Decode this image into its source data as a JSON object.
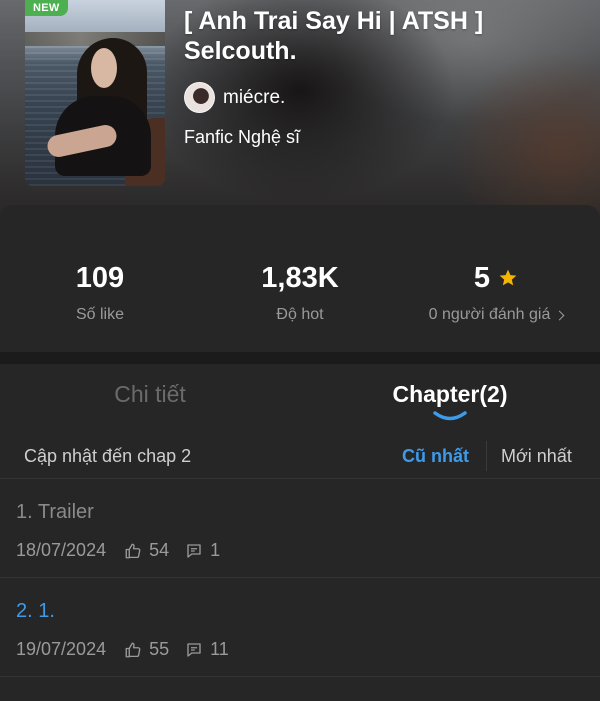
{
  "story": {
    "badge": "NEW",
    "title": "[ Anh Trai Say Hi | ATSH ] Selcouth.",
    "author": "miécre.",
    "genre": "Fanfic Nghệ sĩ"
  },
  "stats": {
    "likes": {
      "value": "109",
      "label": "Số like"
    },
    "hot": {
      "value": "1,83K",
      "label": "Độ hot"
    },
    "rating": {
      "value": "5",
      "label": "0 người đánh giá"
    }
  },
  "tabs": {
    "detail": "Chi tiết",
    "chapters": "Chapter(2)",
    "active": "chapters"
  },
  "chapter_list": {
    "update_text": "Cập nhật đến chap 2",
    "sort_oldest": "Cũ nhất",
    "sort_newest": "Mới nhất",
    "sort_active": "oldest",
    "items": [
      {
        "title": "1. Trailer",
        "date": "18/07/2024",
        "likes": "54",
        "comments": "1",
        "read": true
      },
      {
        "title": "2. 1.",
        "date": "19/07/2024",
        "likes": "55",
        "comments": "11",
        "read": false
      }
    ]
  },
  "colors": {
    "accent": "#3d9be9",
    "star": "#f5b400",
    "badge": "#4caf50",
    "background": "#262626"
  },
  "icons": [
    "star-icon",
    "chevron-right-icon",
    "thumbs-up-icon",
    "comment-icon"
  ]
}
